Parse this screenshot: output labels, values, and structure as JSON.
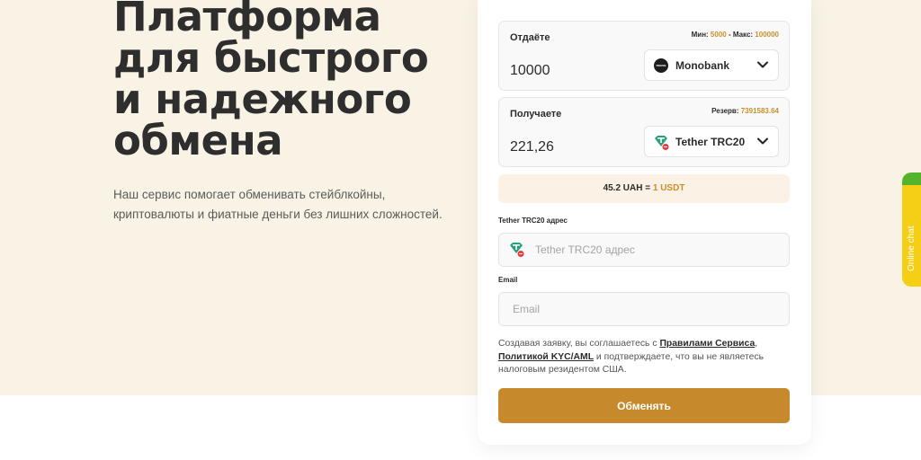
{
  "hero": {
    "title_lines": [
      "Платформа",
      "для быстрого",
      "и надежного",
      "обмена"
    ],
    "description_lines": [
      "Наш сервис помогает обменивать стейблкойны,",
      "криптовалюты и фиатные деньги без лишних сложностей."
    ]
  },
  "give": {
    "label": "Отдаёте",
    "min_label": "Мин:",
    "min_value": "5000",
    "separator": " - ",
    "max_label": "Макс:",
    "max_value": "100000",
    "amount": "10000",
    "currency": "Monobank",
    "currency_logo_text": "mono"
  },
  "get": {
    "label": "Получаете",
    "reserve_label": "Резерв:",
    "reserve_value": "7391583.64",
    "amount": "221,26",
    "currency": "Tether TRC20"
  },
  "rate": {
    "from": "45.2 UAH =",
    "to": "1 USDT"
  },
  "address": {
    "label": "Tether TRC20 адрес",
    "placeholder": "Tether TRC20 адрес"
  },
  "email": {
    "label": "Email",
    "placeholder": "Email"
  },
  "consent": {
    "prefix": "Создавая заявку, вы соглашаетесь с ",
    "rules_link": "Правилами Сервиса",
    "comma": ",",
    "kyc_link": "Политикой KYC/AML",
    "suffix": " и подтверждаете, что вы не являетесь налоговым резидентом США."
  },
  "submit_label": "Обменять",
  "online_chat_label": "Online chat",
  "colors": {
    "accent": "#c6892b",
    "hero_bg": "#f8f3e4",
    "tether_green": "#26a17b",
    "badge_red": "#e53935",
    "chat_yellow": "#f5ce16"
  },
  "icons": [
    "monobank-logo-icon",
    "chevron-down-icon",
    "tether-icon"
  ]
}
